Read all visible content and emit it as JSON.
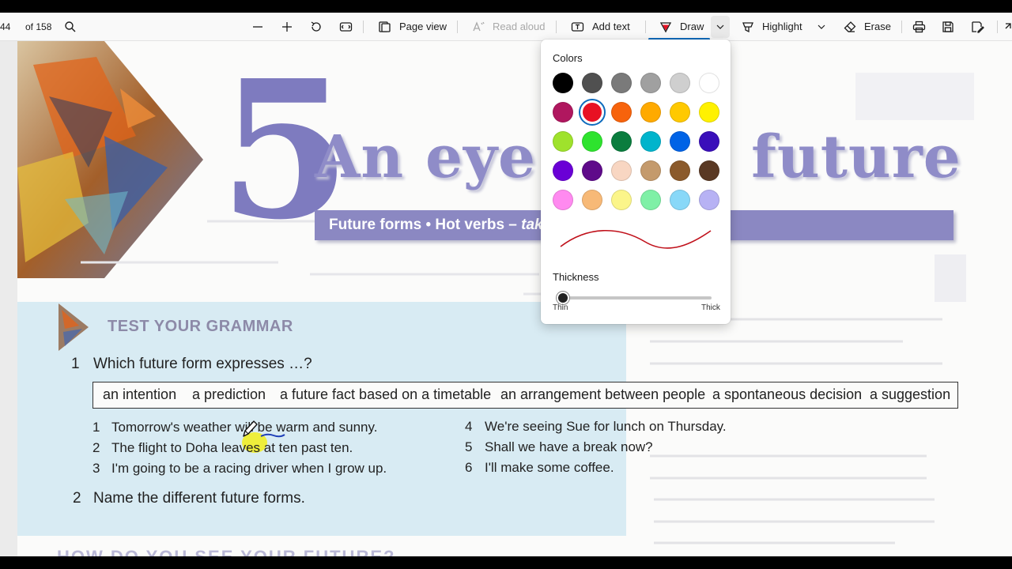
{
  "toolbar": {
    "page_current": "44",
    "page_total": "of 158",
    "page_view_label": "Page view",
    "read_aloud_label": "Read aloud",
    "add_text_label": "Add text",
    "draw_label": "Draw",
    "highlight_label": "Highlight",
    "erase_label": "Erase"
  },
  "document": {
    "chapter_number": "5",
    "chapter_title": "An eye t",
    "chapter_title_right": "future",
    "subtitle_part1": "Future forms  •  Hot verbs – ",
    "subtitle_part2": "tak",
    "section_heading": "TEST YOUR GRAMMAR",
    "question1_num": "1",
    "question1_text": "Which future form expresses …?",
    "terms": [
      "an intention",
      "a prediction",
      "a future fact based on a timetable",
      "an arrangement between people",
      "a spontaneous decision",
      "a suggestion"
    ],
    "items_left": [
      {
        "num": "1",
        "text": "Tomorrow's weather will be warm and sunny."
      },
      {
        "num": "2",
        "text": "The flight to Doha leaves at ten past ten."
      },
      {
        "num": "3",
        "text": "I'm going to be a racing driver when I grow up."
      }
    ],
    "items_right": [
      {
        "num": "4",
        "text": "We're seeing Sue for lunch on Thursday."
      },
      {
        "num": "5",
        "text": "Shall we have a break now?"
      },
      {
        "num": "6",
        "text": "I'll make some coffee."
      }
    ],
    "question2_num": "2",
    "question2_text": "Name the different future forms.",
    "bottom_heading": "HOW DO YOU SEE YOUR FUTURE?"
  },
  "draw_panel": {
    "colors_label": "Colors",
    "colors": [
      [
        "#000000",
        "#505050",
        "#7a7a7a",
        "#a0a0a0",
        "#cfcfcf",
        "#ffffff"
      ],
      [
        "#b0175f",
        "#e81123",
        "#f7630c",
        "#ffaa00",
        "#ffc900",
        "#fff100"
      ],
      [
        "#9fe22c",
        "#2ee32e",
        "#0a7d3e",
        "#00b4cc",
        "#0063e6",
        "#3a0fba"
      ],
      [
        "#6a00d6",
        "#5f0a8a",
        "#f8d6c2",
        "#c49a6c",
        "#8b5a2b",
        "#5a3924"
      ],
      [
        "#ff8af0",
        "#f7b977",
        "#fbf58a",
        "#7ff0a6",
        "#88d8f8",
        "#b7b2f4"
      ]
    ],
    "selected_color": "#e81123",
    "stroke_color": "#c0101a",
    "thickness_label": "Thickness",
    "thickness_value": 0.03,
    "thin_label": "Thin",
    "thick_label": "Thick"
  }
}
